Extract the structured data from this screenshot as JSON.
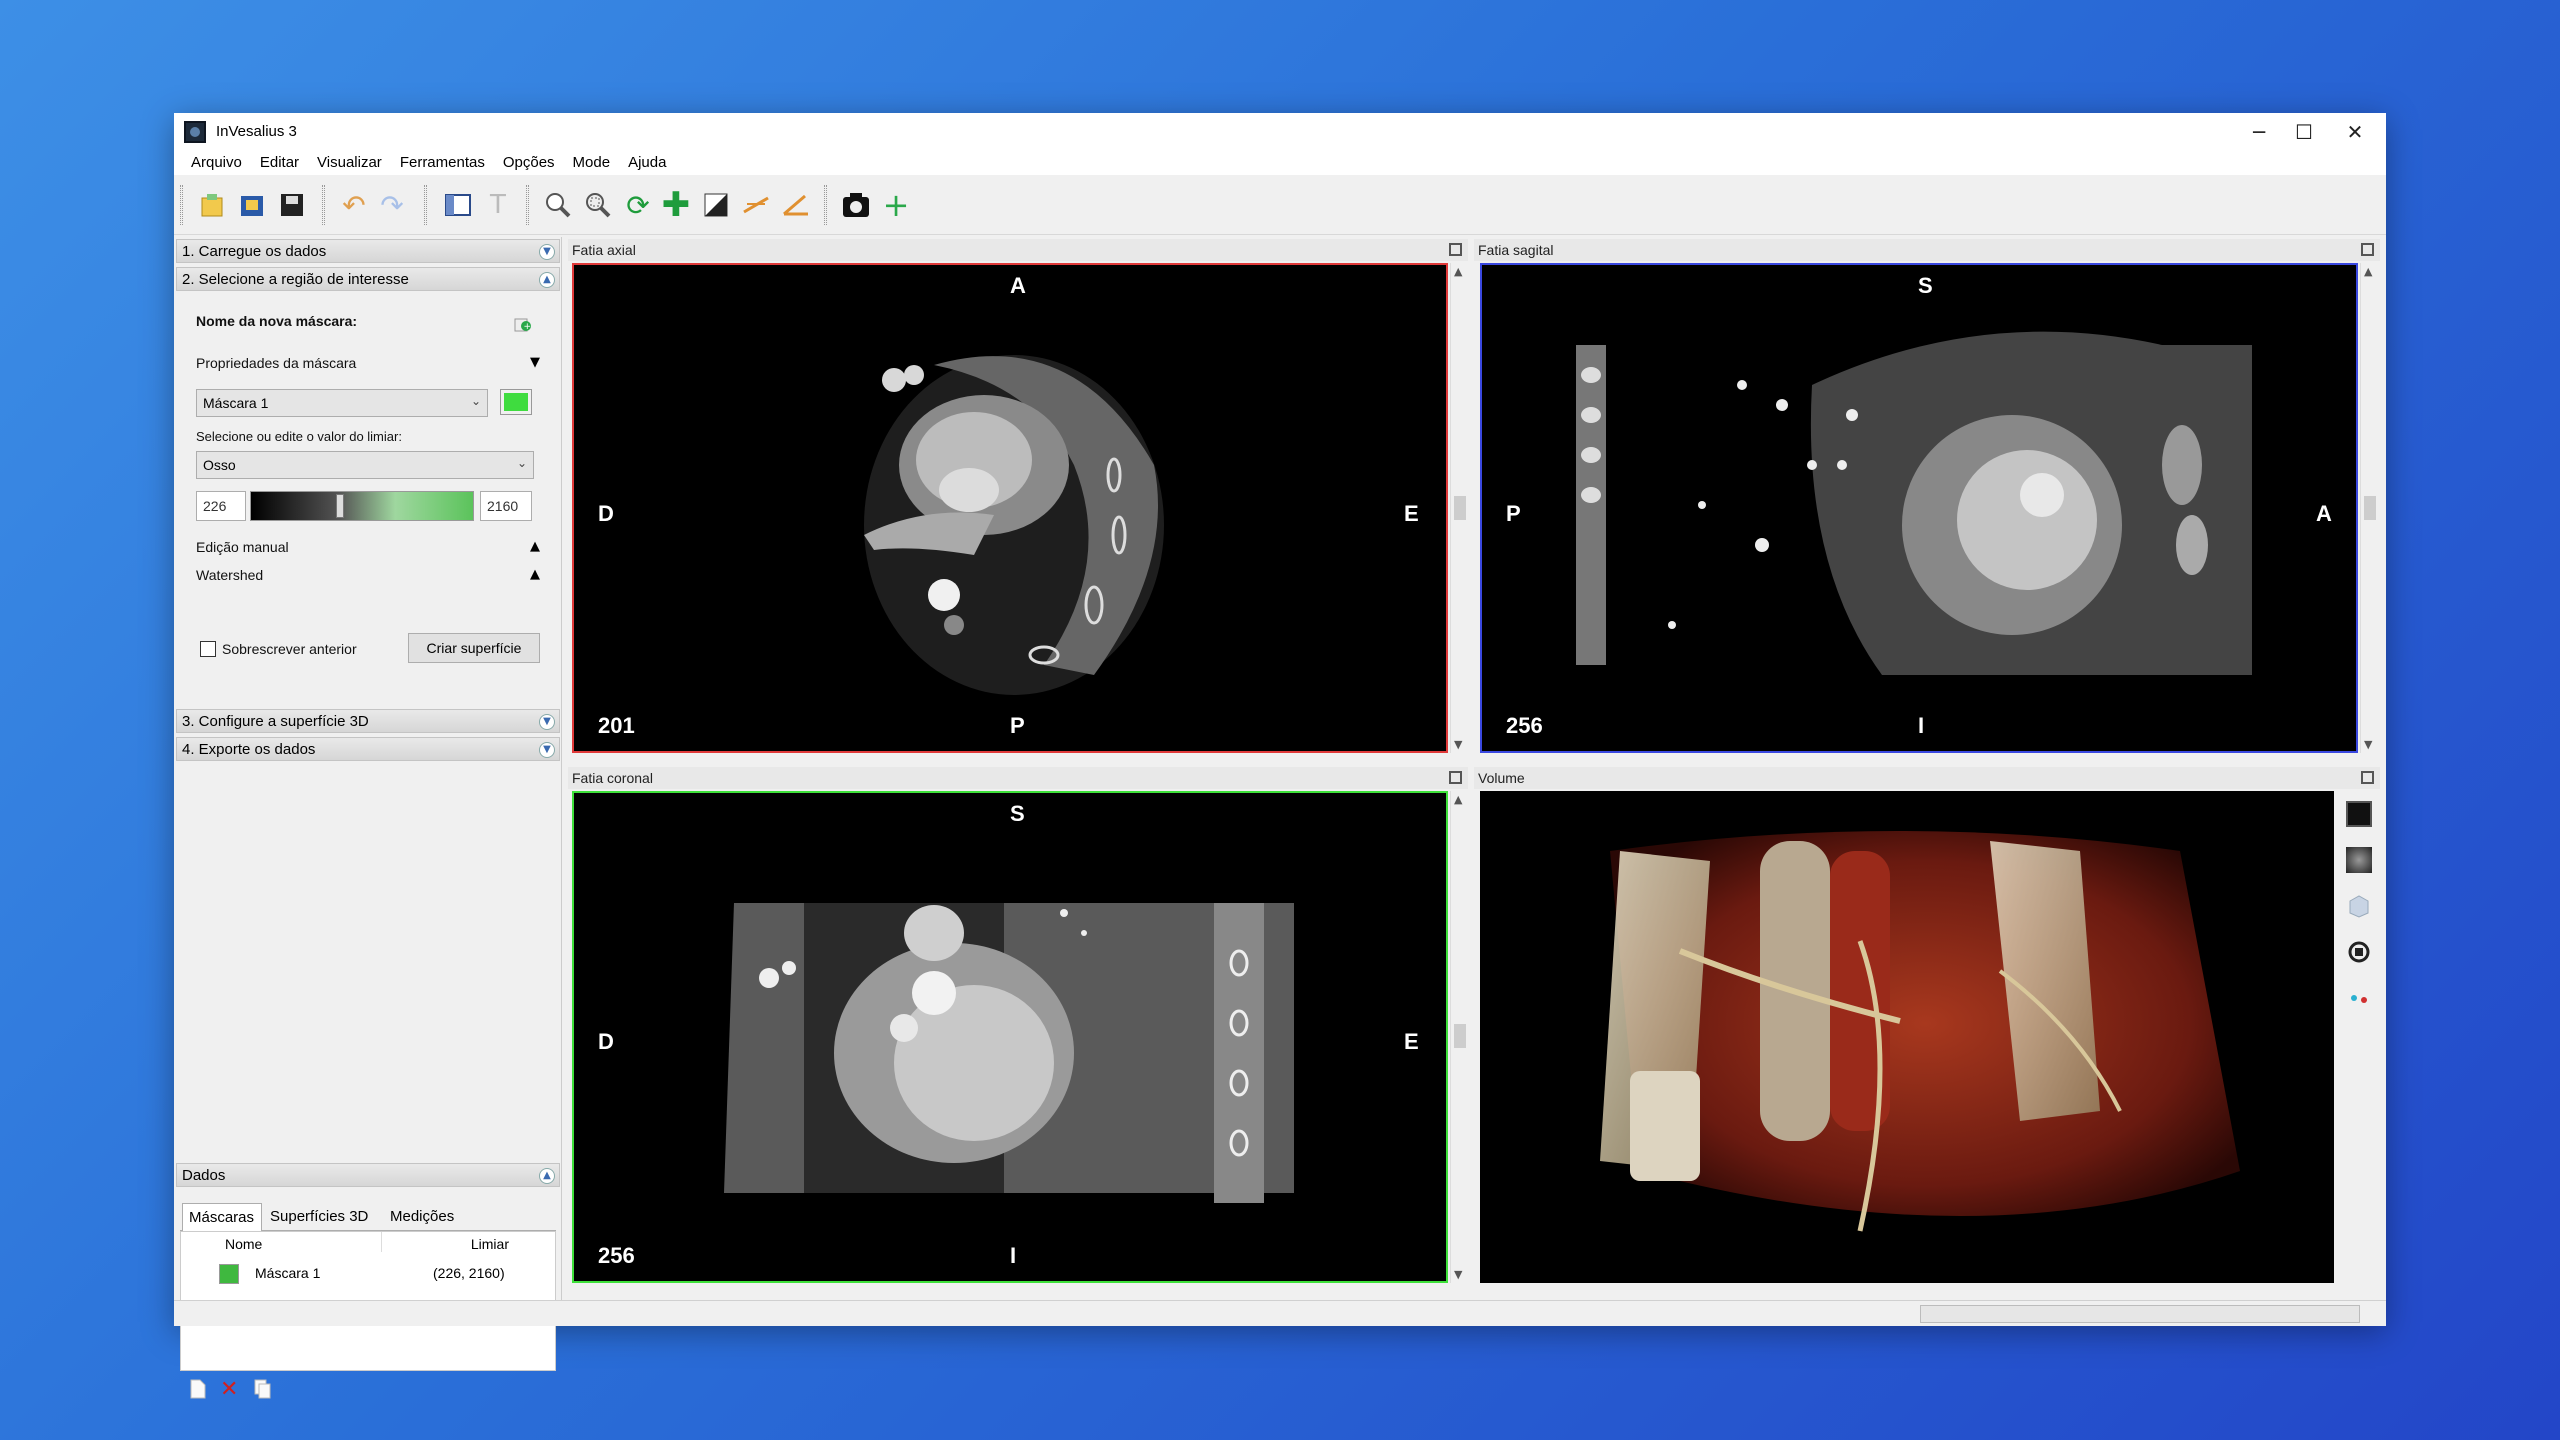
{
  "window": {
    "title": "InVesalius 3",
    "controls": {
      "minimize": "─",
      "maximize": "☐",
      "close": "✕"
    }
  },
  "menu": [
    "Arquivo",
    "Editar",
    "Visualizar",
    "Ferramentas",
    "Opções",
    "Mode",
    "Ajuda"
  ],
  "toolbar": {
    "icons": [
      "import-icon",
      "open-icon",
      "save-icon",
      "undo-icon",
      "redo-icon",
      "layout-icon",
      "text-icon",
      "zoom-icon",
      "zoom-select-icon",
      "rotate-icon",
      "pan-icon",
      "contrast-icon",
      "measure-linear-icon",
      "measure-angle-icon",
      "screenshot-icon",
      "add-icon"
    ]
  },
  "sections": {
    "s1": "1. Carregue os dados",
    "s2": "2. Selecione a região de interesse",
    "s3": "3. Configure a superfície 3D",
    "s4": "4. Exporte os dados",
    "dados": "Dados"
  },
  "mask_panel": {
    "new_mask_label": "Nome da nova máscara:",
    "properties_label": "Propriedades da máscara",
    "mask_select": "Máscara 1",
    "mask_color": "#3fdc3f",
    "threshold_label": "Selecione ou edite o valor do limiar:",
    "threshold_select": "Osso",
    "threshold_min": "226",
    "threshold_max": "2160",
    "threshold_fraction": 0.4,
    "manual_edit": "Edição manual",
    "watershed": "Watershed",
    "overwrite_label": "Sobrescrever anterior",
    "create_surface": "Criar superfície"
  },
  "data_panel": {
    "tabs": [
      "Máscaras",
      "Superfícies 3D",
      "Medições"
    ],
    "columns": [
      "Nome",
      "Limiar"
    ],
    "rows": [
      {
        "name": "Máscara 1",
        "limiar": "(226, 2160)",
        "color": "#3fb83f"
      }
    ]
  },
  "views": {
    "axial": {
      "title": "Fatia axial",
      "top": "A",
      "bottom": "P",
      "left": "D",
      "right": "E",
      "slice": "201",
      "border": "#e03a3a"
    },
    "sagittal": {
      "title": "Fatia sagital",
      "top": "S",
      "bottom": "I",
      "left": "P",
      "right": "A",
      "slice": "256",
      "border": "#3a48e0"
    },
    "coronal": {
      "title": "Fatia coronal",
      "top": "S",
      "bottom": "I",
      "left": "D",
      "right": "E",
      "slice": "256",
      "border": "#3ee03a"
    },
    "volume": {
      "title": "Volume"
    }
  },
  "colors": {
    "accent_axial": "#e03a3a",
    "accent_sagittal": "#3a48e0",
    "accent_coronal": "#3ee03a"
  }
}
